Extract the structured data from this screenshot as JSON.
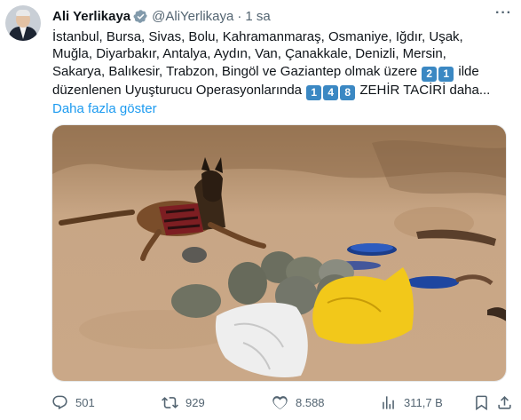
{
  "tweet": {
    "author_name": "Ali Yerlikaya",
    "handle": "@AliYerlikaya",
    "separator": "·",
    "time": "1 sa",
    "lines": [
      "İstanbul, Bursa, Sivas, Bolu, Kahramanmaraş, Osmaniye, Iğdır, Uşak,",
      "Muğla, Diyarbakır, Antalya, Aydın, Van, Çanakkale, Denizli, Mersin,"
    ],
    "line3_text": "Sakarya, Balıkesir, Trabzon, Bingöl ve Gaziantep  olmak üzere",
    "line3_keycaps": [
      "2",
      "1"
    ],
    "line3_suffix": "ilde",
    "line4_text": "düzenlenen Uyuşturucu Operasyonlarında",
    "line4_keycaps": [
      "1",
      "4",
      "8"
    ],
    "line4_suffix": "ZEHİR TACİRİ daha...",
    "show_more": "Daha fazla göster"
  },
  "metrics": {
    "replies": "501",
    "retweets": "929",
    "likes": "8.588",
    "views": "311,7 B"
  },
  "colors": {
    "link": "#1d9bf0",
    "muted": "#536471",
    "verified_badge": "#829aab",
    "keycap": "#3b88c3"
  },
  "icons": [
    "verified-icon",
    "more-icon",
    "reply-icon",
    "retweet-icon",
    "like-icon",
    "views-icon",
    "bookmark-icon",
    "share-icon"
  ]
}
